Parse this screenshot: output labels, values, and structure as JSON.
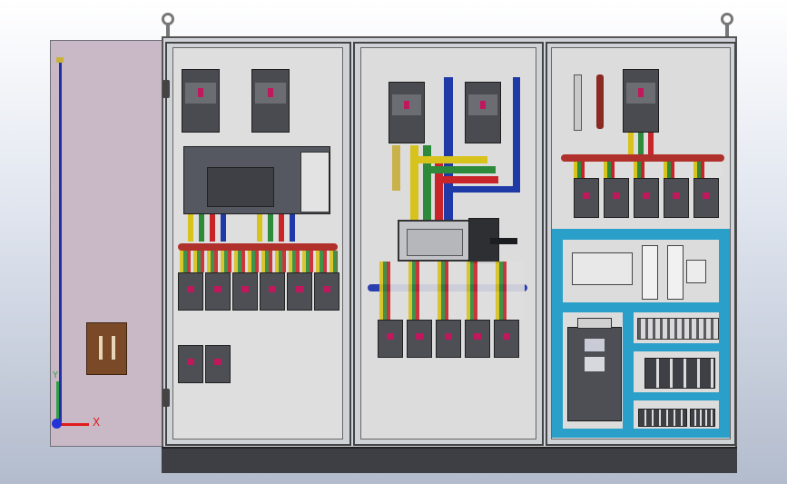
{
  "axes": {
    "x_label": "X",
    "y_label": "Y",
    "x_color": "#e01b1b",
    "y_color": "#2ea043",
    "z_color": "#2432d8"
  },
  "colors": {
    "cabinet": "#cfd2d8",
    "door": "#c9b8c6",
    "busbar_red": "#c8242a",
    "busbar_blue": "#1f3aa6",
    "busbar_yellow": "#d8c21c",
    "busbar_green": "#2c8a3a",
    "din_rail": "#2a9fc9"
  },
  "vfd": {
    "label": ""
  }
}
